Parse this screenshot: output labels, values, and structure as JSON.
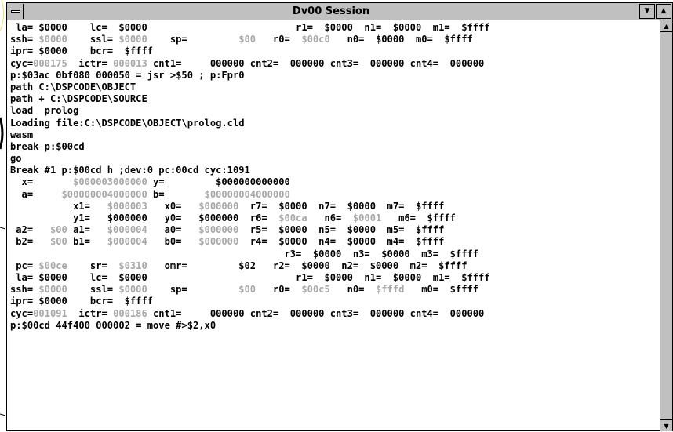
{
  "window": {
    "title": "Dv00 Session",
    "minimize_glyph": "▼",
    "maximize_glyph": "▲",
    "scroll_up_glyph": "▲",
    "scroll_down_glyph": "▼"
  },
  "colors": {
    "dim_value": "#a8a8a8",
    "chrome": "#c0c0c0"
  },
  "console_lines": [
    [
      {
        "t": " la= $0000    lc=  $0000                          r1=  $0000  n1=  $0000  m1=  $ffff"
      }
    ],
    [
      {
        "t": "ssh= "
      },
      {
        "t": "$0000",
        "d": true
      },
      {
        "t": "    ssl= "
      },
      {
        "t": "$0000",
        "d": true
      },
      {
        "t": "    sp=         "
      },
      {
        "t": "$00",
        "d": true
      },
      {
        "t": "   r0=  "
      },
      {
        "t": "$00c0",
        "d": true
      },
      {
        "t": "   n0=  $0000  m0=  $ffff"
      }
    ],
    [
      {
        "t": "ipr= $0000    bcr=  $ffff"
      }
    ],
    [
      {
        "t": "cyc="
      },
      {
        "t": "000175",
        "d": true
      },
      {
        "t": "  ictr= "
      },
      {
        "t": "000013",
        "d": true
      },
      {
        "t": " cnt1=     000000 cnt2=  000000 cnt3=  000000 cnt4=  000000"
      }
    ],
    [
      {
        "t": "p:$03ac 0bf080 000050 = jsr >$50 ; p:Fpr0"
      }
    ],
    [
      {
        "t": "path C:\\DSPCODE\\OBJECT"
      }
    ],
    [
      {
        "t": "path + C:\\DSPCODE\\SOURCE"
      }
    ],
    [
      {
        "t": "load  prolog"
      }
    ],
    [
      {
        "t": "Loading file:C:\\DSPCODE\\OBJECT\\prolog.cld"
      }
    ],
    [
      {
        "t": "wasm"
      }
    ],
    [
      {
        "t": "break p:$00cd"
      }
    ],
    [
      {
        "t": "go"
      }
    ],
    [
      {
        "t": "Break #1 p:$00cd h ;dev:0 pc:00cd cyc:1091"
      }
    ],
    [
      {
        "t": "  x=       "
      },
      {
        "t": "$000003000000",
        "d": true
      },
      {
        "t": " y=         $000000000000"
      }
    ],
    [
      {
        "t": "  a=     "
      },
      {
        "t": "$00000004000000",
        "d": true
      },
      {
        "t": " b=       "
      },
      {
        "t": "$00000004000000",
        "d": true
      }
    ],
    [
      {
        "t": "           x1=   "
      },
      {
        "t": "$000003",
        "d": true
      },
      {
        "t": "   x0=   "
      },
      {
        "t": "$000000",
        "d": true
      },
      {
        "t": "  r7=  $0000  n7=  $0000  m7=  $ffff"
      }
    ],
    [
      {
        "t": "           y1=   $000000   y0=   $000000  r6=  "
      },
      {
        "t": "$00ca",
        "d": true
      },
      {
        "t": "   n6=  "
      },
      {
        "t": "$0001",
        "d": true
      },
      {
        "t": "   m6=  $ffff"
      }
    ],
    [
      {
        "t": " a2=   "
      },
      {
        "t": "$00",
        "d": true
      },
      {
        "t": " a1=   "
      },
      {
        "t": "$000004",
        "d": true
      },
      {
        "t": "   a0=   "
      },
      {
        "t": "$000000",
        "d": true
      },
      {
        "t": "  r5=  $0000  n5=  $0000  m5=  $ffff"
      }
    ],
    [
      {
        "t": " b2=   "
      },
      {
        "t": "$00",
        "d": true
      },
      {
        "t": " b1=   "
      },
      {
        "t": "$000004",
        "d": true
      },
      {
        "t": "   b0=   "
      },
      {
        "t": "$000000",
        "d": true
      },
      {
        "t": "  r4=  $0000  n4=  $0000  m4=  $ffff"
      }
    ],
    [
      {
        "t": "                                                r3=  $0000  n3=  $0000  m3=  $ffff"
      }
    ],
    [
      {
        "t": " pc= "
      },
      {
        "t": "$00ce",
        "d": true
      },
      {
        "t": "    sr=  "
      },
      {
        "t": "$0310",
        "d": true
      },
      {
        "t": "   omr=         $02   r2=  $0000  n2=  $0000  m2=  $ffff"
      }
    ],
    [
      {
        "t": " la= $0000    lc=  $0000                          r1=  $0000  n1=  $0000  m1=  $ffff"
      }
    ],
    [
      {
        "t": "ssh= "
      },
      {
        "t": "$0000",
        "d": true
      },
      {
        "t": "    ssl= "
      },
      {
        "t": "$0000",
        "d": true
      },
      {
        "t": "    sp=         "
      },
      {
        "t": "$00",
        "d": true
      },
      {
        "t": "   r0=  "
      },
      {
        "t": "$00c5",
        "d": true
      },
      {
        "t": "   n0=  "
      },
      {
        "t": "$fffd",
        "d": true
      },
      {
        "t": "   m0=  $ffff"
      }
    ],
    [
      {
        "t": "ipr= $0000    bcr=  $ffff"
      }
    ],
    [
      {
        "t": "cyc="
      },
      {
        "t": "001091",
        "d": true
      },
      {
        "t": "  ictr= "
      },
      {
        "t": "000186",
        "d": true
      },
      {
        "t": " cnt1=     000000 cnt2=  000000 cnt3=  000000 cnt4=  000000"
      }
    ],
    [
      {
        "t": "p:$00cd 44f400 000002 = move #>$2,x0"
      }
    ]
  ]
}
